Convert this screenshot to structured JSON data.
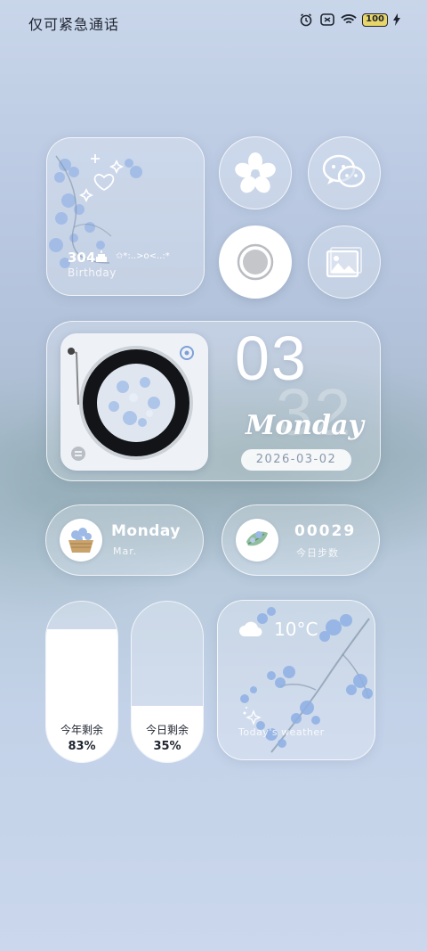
{
  "status_bar": {
    "carrier_text": "仅可紧急通话",
    "battery": "100",
    "icons": [
      "alarm-icon",
      "sim-icon",
      "wifi-icon",
      "battery-icon",
      "charging-icon"
    ]
  },
  "birthday_widget": {
    "count": "304",
    "decoration": "✩*:..>o<..:*",
    "label": "Birthday"
  },
  "app_buttons": [
    {
      "name": "flower-app-icon"
    },
    {
      "name": "chat-app-icon"
    },
    {
      "name": "record-app-icon"
    },
    {
      "name": "gallery-app-icon"
    }
  ],
  "music_widget": {
    "day": "03",
    "ghost_number": "32",
    "weekday": "Monday",
    "date": "2026-03-02"
  },
  "day_pill": {
    "title": "Monday",
    "subtitle": "Mar."
  },
  "step_pill": {
    "title": "00029",
    "subtitle": "今日步数"
  },
  "year_remaining": {
    "label": "今年剩余",
    "value": "83%",
    "fraction": 0.83
  },
  "day_remaining": {
    "label": "今日剩余",
    "value": "35%",
    "fraction": 0.35
  },
  "weather_widget": {
    "temperature": "10°C",
    "label": "Today's weather",
    "icon": "cloud-icon"
  },
  "colors": {
    "accent": "#ffffff",
    "text_dark": "#1f2530",
    "date_text": "#8a98ad"
  }
}
